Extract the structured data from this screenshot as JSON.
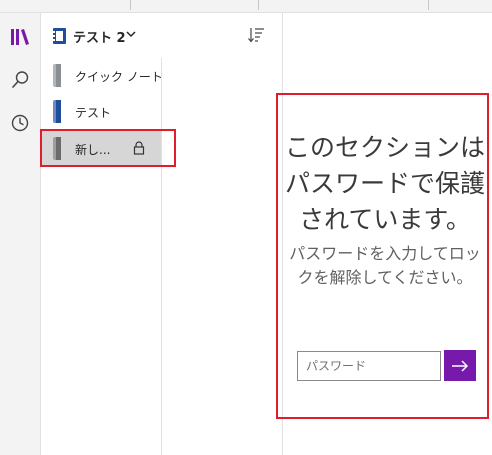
{
  "notebook": {
    "name": "テスト 2"
  },
  "sections": [
    {
      "label": "クイック ノート",
      "color": "#8a8f94"
    },
    {
      "label": "テスト",
      "color": "#1f4e9a"
    },
    {
      "label": "新し...",
      "color": "#6b6b6b",
      "selected": true,
      "locked": true
    }
  ],
  "locked_message": {
    "heading": "このセクションはパスワードで保護されています。",
    "instruction": "パスワードを入力してロックを解除してください。"
  },
  "password": {
    "placeholder": "パスワード",
    "value": ""
  },
  "colors": {
    "accent": "#7719aa",
    "highlight": "#e01e2b",
    "rail": "#f3f3f3"
  },
  "icons": [
    "notebooks-icon",
    "search-icon",
    "recent-icon",
    "notebook-icon",
    "chevron-down-icon",
    "sort-icon",
    "lock-icon",
    "arrow-right-icon"
  ]
}
